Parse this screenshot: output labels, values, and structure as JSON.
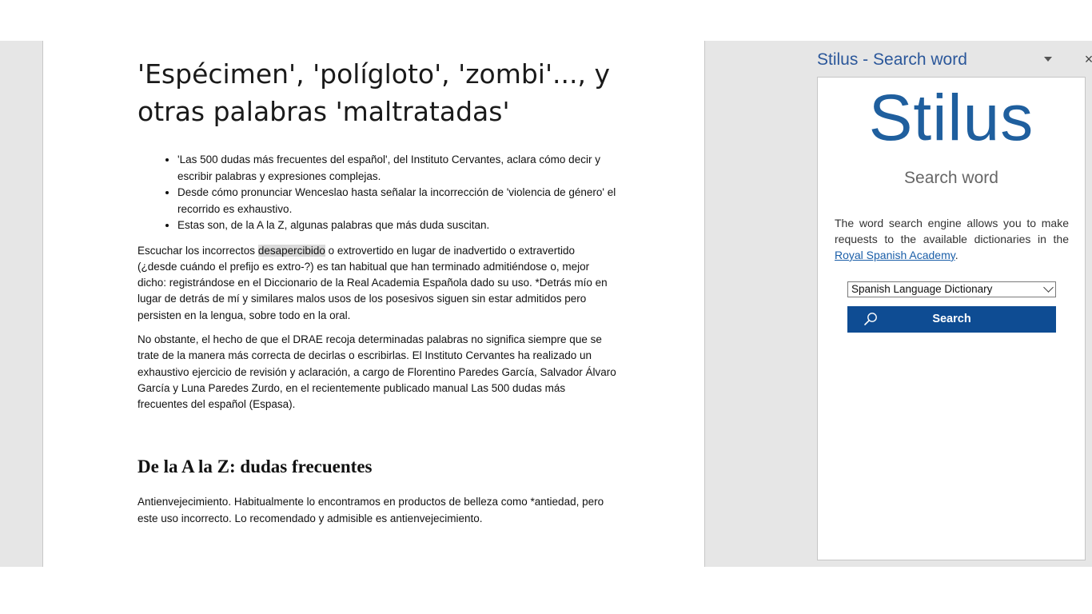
{
  "document": {
    "title": "'Espécimen', 'polígloto', 'zombi'..., y otras palabras 'maltratadas'",
    "bullets": [
      "'Las 500 dudas más frecuentes del español', del Instituto Cervantes, aclara cómo decir y escribir palabras y expresiones complejas.",
      "Desde cómo pronunciar Wenceslao hasta señalar la incorrección de 'violencia de género' el recorrido es exhaustivo.",
      "Estas son, de la A la Z, algunas palabras que más duda suscitan."
    ],
    "paragraph1": {
      "before": "Escuchar los incorrectos ",
      "highlight": "desapercibido",
      "after": " o extrovertido en lugar de inadvertido o extravertido (¿desde cuándo el prefijo es extro-?) es tan habitual que han terminado admitiéndose o, mejor dicho: registrándose en el Diccionario de la Real Academia Española dado su uso. *Detrás mío en lugar de detrás de mí y similares malos usos de los posesivos siguen sin estar admitidos pero persisten en la lengua, sobre todo en la oral."
    },
    "paragraph2": "No obstante, el hecho de que el DRAE recoja determinadas palabras no significa siempre que se trate de la manera más correcta de decirlas o escribirlas. El Instituto Cervantes ha realizado un exhaustivo ejercicio de revisión y aclaración, a cargo de Florentino Paredes García, Salvador Álvaro García y Luna Paredes Zurdo, en el recientemente publicado manual Las 500 dudas más frecuentes del español (Espasa).",
    "heading2": "De la A la Z: dudas frecuentes",
    "paragraph3": "Antienvejecimiento. Habitualmente lo encontramos en productos de belleza como *antiedad, pero este uso incorrecto. Lo recomendado y admisible es antienvejecimiento."
  },
  "pane": {
    "title": "Stilus - Search word",
    "menu_icon": "dropdown-triangle-icon",
    "close_label": "×",
    "logo_text": "Stilus",
    "subtitle": "Search word",
    "description_before": "The word search engine allows you to make requests to the available dictionaries in the ",
    "description_link": "Royal Spanish Academy",
    "description_after": ".",
    "dictionary_selected": "Spanish Language Dictionary",
    "search_button_label": "Search",
    "search_icon": "magnifier-icon",
    "colors": {
      "title": "#2b579a",
      "logo": "#1f5f9e",
      "button": "#0e4c93",
      "link": "#1a5ea8"
    }
  }
}
